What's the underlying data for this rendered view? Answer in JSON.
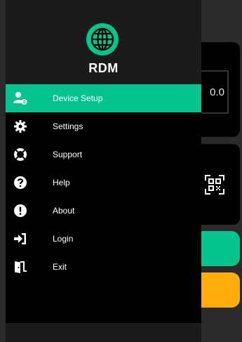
{
  "app": {
    "brand": "RDM",
    "accent": "#06c48e",
    "secondary": "#ffad0a"
  },
  "background": {
    "field_value": "0.0",
    "qr_icon": "qr-code-icon"
  },
  "drawer": {
    "items": [
      {
        "label": "Device Setup",
        "icon": "user-gear-icon",
        "active": true
      },
      {
        "label": "Settings",
        "icon": "gear-icon",
        "active": false
      },
      {
        "label": "Support",
        "icon": "lifebuoy-icon",
        "active": false
      },
      {
        "label": "Help",
        "icon": "question-icon",
        "active": false
      },
      {
        "label": "About",
        "icon": "exclamation-icon",
        "active": false
      },
      {
        "label": "Login",
        "icon": "sign-in-icon",
        "active": false
      },
      {
        "label": "Exit",
        "icon": "door-exit-icon",
        "active": false
      }
    ]
  }
}
